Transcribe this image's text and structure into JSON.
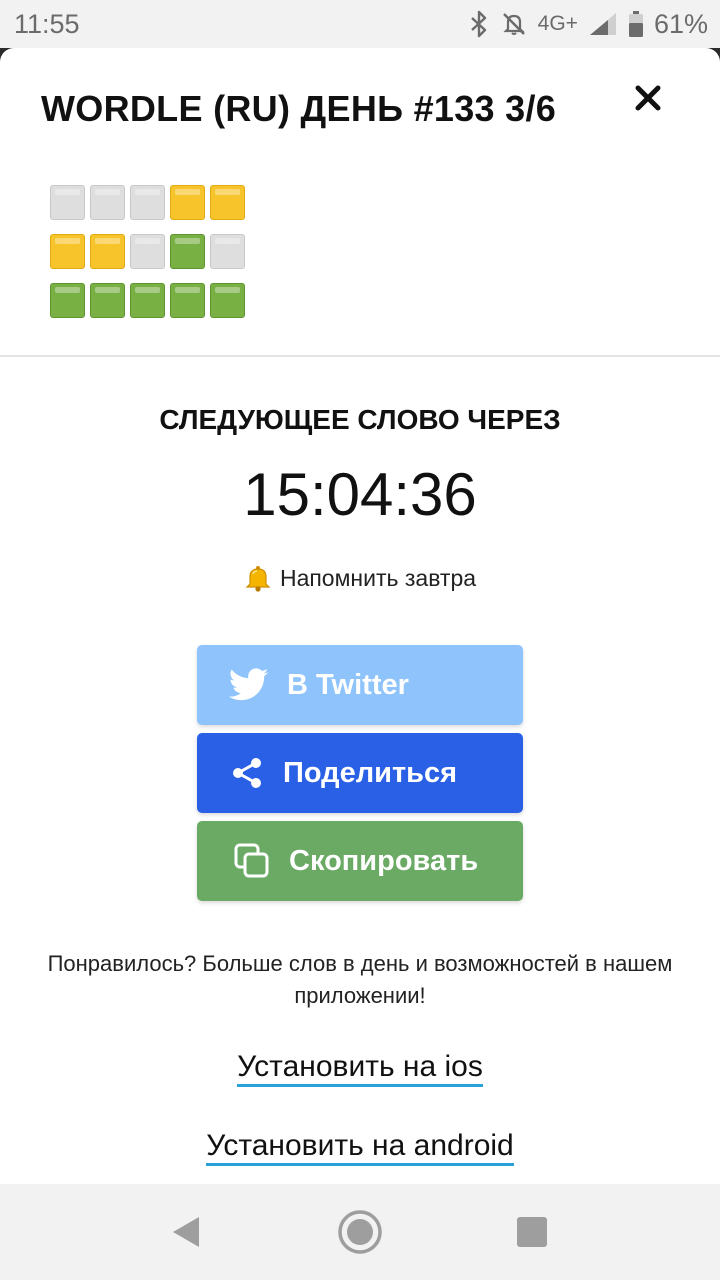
{
  "status_bar": {
    "time": "11:55",
    "network": "4G+",
    "battery": "61%",
    "icons": [
      "bluetooth-icon",
      "mute-icon",
      "signal-icon",
      "battery-icon"
    ]
  },
  "modal": {
    "title": "WORDLE (RU) ДЕНЬ #133 3/6",
    "close_icon": "close-icon",
    "result_grid": [
      [
        "absent",
        "absent",
        "absent",
        "present",
        "present"
      ],
      [
        "present",
        "present",
        "absent",
        "correct",
        "absent"
      ],
      [
        "correct",
        "correct",
        "correct",
        "correct",
        "correct"
      ]
    ],
    "next_word_label": "СЛЕДУЮЩЕЕ СЛОВО ЧЕРЕЗ",
    "countdown": "15:04:36",
    "remind": {
      "icon": "bell-icon",
      "label": "Напомнить завтра"
    },
    "buttons": {
      "twitter": {
        "label": "В Twitter",
        "icon": "twitter-icon",
        "color": "#8ec3fb"
      },
      "share": {
        "label": "Поделиться",
        "icon": "share-icon",
        "color": "#2a60e6"
      },
      "copy": {
        "label": "Скопировать",
        "icon": "copy-icon",
        "color": "#6aaa64"
      }
    },
    "promo_text": "Понравилось? Больше слов в день и возможностей в нашем приложении!",
    "links": {
      "ios": "Установить на ios",
      "android": "Установить на android"
    },
    "colors": {
      "absent": "#dedede",
      "present": "#f7c52b",
      "correct": "#78b043",
      "link_underline": "#2aa0d8"
    }
  },
  "nav_bar": {
    "icons": [
      "back-icon",
      "home-icon",
      "recents-icon"
    ]
  }
}
